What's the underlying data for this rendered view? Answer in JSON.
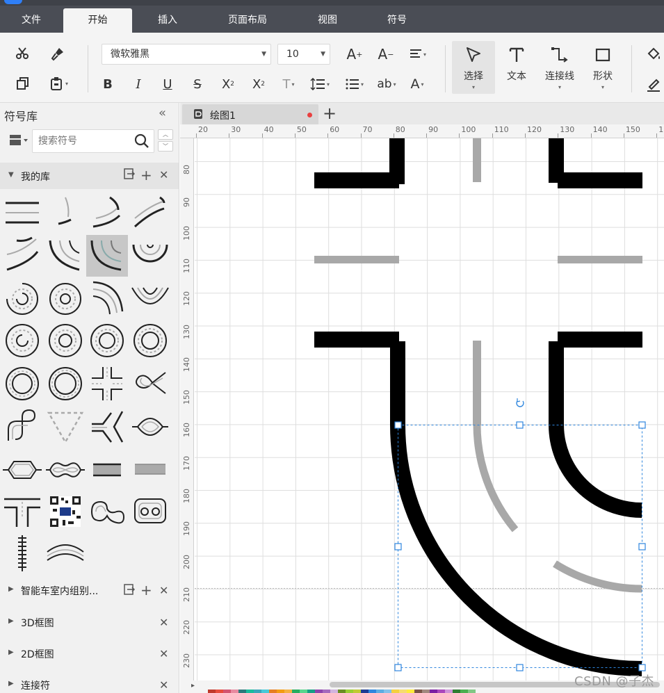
{
  "menu": {
    "tabs": [
      {
        "label": "文件",
        "active": false
      },
      {
        "label": "开始",
        "active": true
      },
      {
        "label": "插入",
        "active": false
      },
      {
        "label": "页面布局",
        "active": false
      },
      {
        "label": "视图",
        "active": false
      },
      {
        "label": "符号",
        "active": false
      }
    ]
  },
  "ribbon": {
    "font_family": "微软雅黑",
    "font_size": "10",
    "tools": [
      {
        "label": "选择",
        "icon": "pointer-icon",
        "active": true
      },
      {
        "label": "文本",
        "icon": "text-icon",
        "active": false
      },
      {
        "label": "连接线",
        "icon": "connector-icon",
        "active": false
      },
      {
        "label": "形状",
        "icon": "shape-icon",
        "active": false
      }
    ]
  },
  "library_panel": {
    "title": "符号库",
    "search_placeholder": "搜索符号",
    "my_library": "我的库",
    "collapsed_libraries": [
      {
        "label": "智能车室内组别...",
        "has_export": true
      },
      {
        "label": "3D框图",
        "has_export": false
      },
      {
        "label": "2D框图",
        "has_export": false
      },
      {
        "label": "连接符",
        "has_export": false
      }
    ]
  },
  "document": {
    "tab_title": "绘图1",
    "unsaved": true
  },
  "rulers": {
    "horizontal": [
      "20",
      "30",
      "40",
      "50",
      "60",
      "70",
      "80",
      "90",
      "100",
      "110",
      "120",
      "130",
      "140",
      "150",
      "1"
    ],
    "vertical": [
      "80",
      "90",
      "100",
      "110",
      "120",
      "130",
      "140",
      "150",
      "160",
      "170",
      "180",
      "190",
      "200",
      "210",
      "220",
      "230"
    ]
  },
  "watermark": "CSDN @子杰",
  "colors": {
    "menubar_bg": "#4a4d55",
    "selection": "#2e86de",
    "track_black": "#000000",
    "track_gray": "#a8a8a8",
    "unsaved_dot": "#e94040"
  }
}
